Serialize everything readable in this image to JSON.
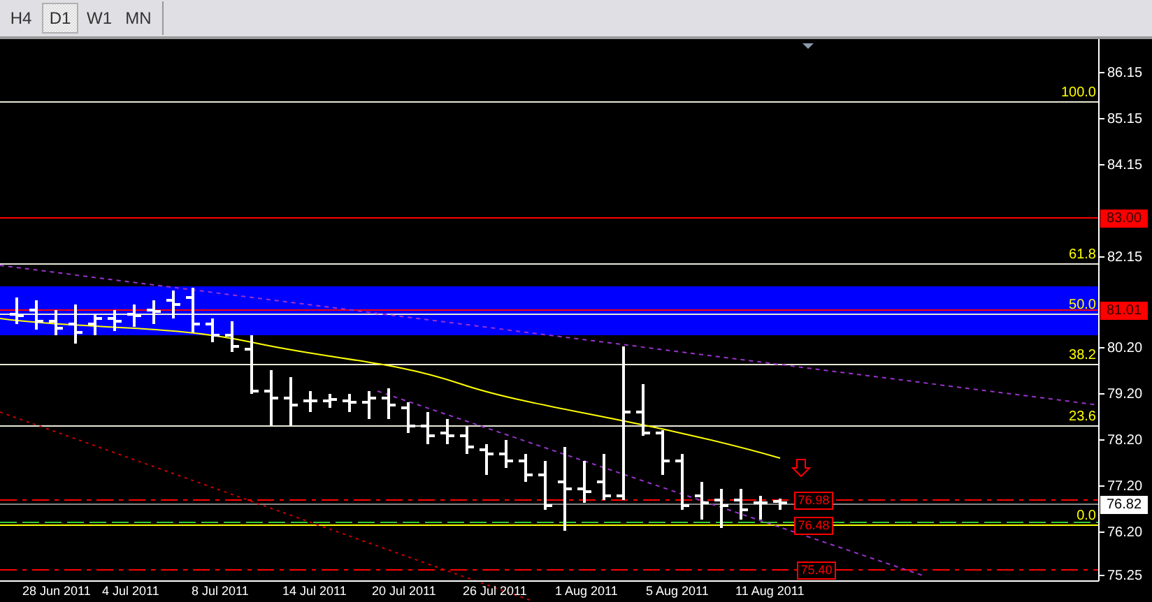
{
  "tabs": [
    {
      "label": "H4",
      "selected": false
    },
    {
      "label": "D1",
      "selected": true
    },
    {
      "label": "W1",
      "selected": false
    },
    {
      "label": "MN",
      "selected": false
    }
  ],
  "price_axis": {
    "ticks": [
      "86.15",
      "85.15",
      "84.15",
      "82.15",
      "80.20",
      "79.20",
      "78.20",
      "77.20",
      "76.20",
      "75.25"
    ],
    "current_price": "76.82"
  },
  "fib_levels": [
    "100.0",
    "61.8",
    "50.0",
    "38.2",
    "23.6",
    "0.0"
  ],
  "price_tags": [
    {
      "kind": "axis",
      "label": "83.00"
    },
    {
      "kind": "axis",
      "label": "81.01"
    },
    {
      "kind": "chart",
      "label": "76.98"
    },
    {
      "kind": "chart",
      "label": "76.48"
    },
    {
      "kind": "chart",
      "label": "75.40"
    }
  ],
  "dates": [
    "28 Jun 2011",
    "4 Jul 2011",
    "8 Jul 2011",
    "14 Jul 2011",
    "20 Jul 2011",
    "26 Jul 2011",
    "1 Aug 2011",
    "5 Aug 2011",
    "11 Aug 2011"
  ]
}
